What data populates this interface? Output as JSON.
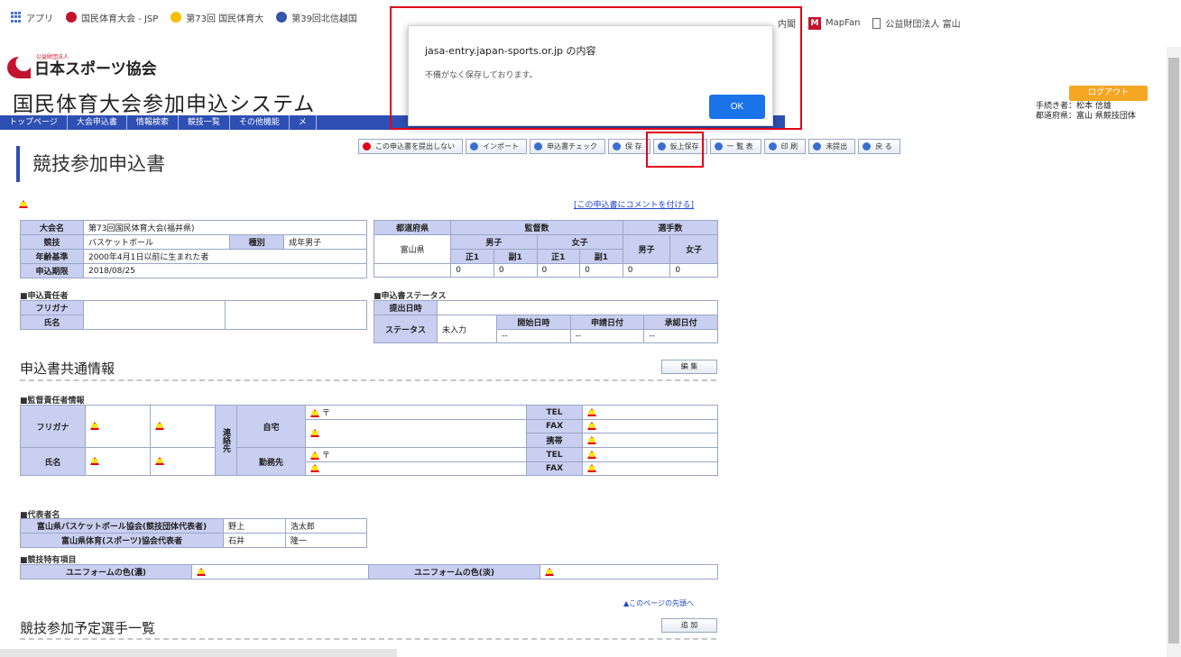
{
  "bookmarks": [
    {
      "label": "アプリ",
      "color": "#4a72c8"
    },
    {
      "label": "国民体育大会 - JSP",
      "color": "#c4122f"
    },
    {
      "label": "第73回 国民体育大",
      "color": "#f5c000"
    },
    {
      "label": "第39回北信越国",
      "color": "#3355aa"
    }
  ],
  "bookmarks_right": {
    "partial": "内閣",
    "mapfan": "MapFan",
    "last": "公益財団法人 富山"
  },
  "site": {
    "org_small": "公益財団法人",
    "org_name": "日本スポーツ協会",
    "system_title": "国民体育大会参加申込システム",
    "logout": "ログアウト",
    "user_line1": "手続き者：松本 信雄",
    "user_line2": "都道府県：富山 県競技団体"
  },
  "nav": [
    "トップページ",
    "大会申込書",
    "情報検索",
    "競技一覧",
    "その他機能",
    "メ"
  ],
  "toolbar": [
    {
      "label": "この申込書を提出しない",
      "color": "#e0001a"
    },
    {
      "label": "インポート",
      "color": "#3a6fd0"
    },
    {
      "label": "申込書チェック",
      "color": "#3a6fd0"
    },
    {
      "label": "保 存",
      "color": "#3a6fd0"
    },
    {
      "label": "仮上保存",
      "color": "#3a6fd0"
    },
    {
      "label": "一 覧 表",
      "color": "#3a6fd0"
    },
    {
      "label": "印 刷",
      "color": "#3a6fd0"
    },
    {
      "label": "未提出",
      "color": "#3a6fd0"
    },
    {
      "label": "戻 る",
      "color": "#3a6fd0"
    }
  ],
  "page_heading": "競技参加申込書",
  "comment_link": "[この申込書にコメントを付ける]",
  "entry_info": {
    "rows": [
      {
        "label": "大会名",
        "value": "第73回国民体育大会(福井県)"
      },
      {
        "label": "競技",
        "value": "バスケットボール",
        "label2": "種別",
        "value2": "成年男子"
      },
      {
        "label": "年齢基準",
        "value": "2000年4月1日以前に生まれた者"
      },
      {
        "label": "申込期限",
        "value": "2018/08/25"
      }
    ]
  },
  "counts": {
    "headers": {
      "pref": "都道府県",
      "officials": "監督数",
      "players": "選手数",
      "male": "男子",
      "female": "女子",
      "main": "正1",
      "sub": "副1"
    },
    "pref_name": "富山県",
    "values": [
      "0",
      "0",
      "0",
      "0",
      "0",
      "0"
    ]
  },
  "applicant": {
    "section": "■申込責任者",
    "furigana": "フリガナ",
    "name": "氏名"
  },
  "status": {
    "section": "■申込書ステータス",
    "submit_time": "提出日時",
    "status_label": "ステータス",
    "status_value": "未入力",
    "col1": "開始日時",
    "col2": "申請日付",
    "col3": "承認日付",
    "v1": "--",
    "v2": "--",
    "v3": "--"
  },
  "common": {
    "title": "申込書共通情報",
    "edit": "編 集",
    "contact_section": "■監督責任者情報",
    "furigana": "フリガナ",
    "name": "氏名",
    "renraku": "連絡先",
    "home": "自宅",
    "work": "勤務先",
    "zip": "〒",
    "tel": "TEL",
    "fax": "FAX",
    "mobile": "携帯"
  },
  "reps": {
    "section": "■代表者名",
    "rows": [
      {
        "org": "富山県バスケットボール協会(競技団体代表者)",
        "surname": "野上",
        "given": "浩太郎"
      },
      {
        "org": "富山県体育(スポーツ)協会代表者",
        "surname": "石井",
        "given": "隆一"
      }
    ]
  },
  "uniform": {
    "section": "■競技特有項目",
    "primary": "ユニフォームの色(濃)",
    "secondary": "ユニフォームの色(淡)"
  },
  "top_link": "▲このページの先頭へ",
  "players": {
    "title": "競技参加予定選手一覧",
    "add": "追 加"
  },
  "dialog": {
    "title": "jasa-entry.japan-sports.or.jp の内容",
    "message": "不備がなく保存しております。",
    "ok": "OK"
  }
}
